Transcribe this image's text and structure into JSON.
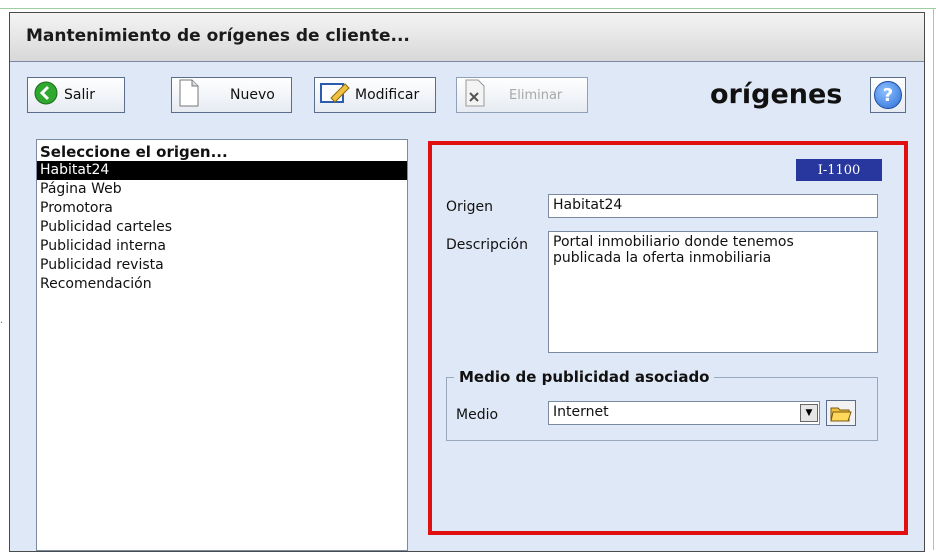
{
  "window": {
    "title": "Mantenimiento de orígenes de cliente..."
  },
  "toolbar": {
    "exit_label": "Salir",
    "new_label": "Nuevo",
    "modify_label": "Modificar",
    "delete_label": "Eliminar",
    "section_word": "orígenes",
    "help_symbol": "?"
  },
  "list": {
    "header": "Seleccione el origen...",
    "items": [
      "Habitat24",
      "Página Web",
      "Promotora",
      "Publicidad carteles",
      "Publicidad interna",
      "Publicidad revista",
      "Recomendación"
    ],
    "selected_index": 0
  },
  "detail": {
    "code": "I-1100",
    "origin_label": "Origen",
    "origin_value": "Habitat24",
    "description_label": "Descripción",
    "description_line1": "Portal inmobiliario donde tenemos",
    "description_line2": "publicada la oferta inmobiliaria",
    "group_title": "Medio de publicidad asociado",
    "medium_label": "Medio",
    "medium_value": "Internet"
  },
  "colors": {
    "accent_red": "#e01010",
    "code_bg": "#27379e",
    "panel_bg": "#dfe8f6"
  },
  "icons": {
    "exit": "green-arrow-left-icon",
    "new": "blank-page-icon",
    "modify": "edit-pencil-icon",
    "delete": "delete-page-icon",
    "help": "help-icon",
    "folder": "open-folder-icon"
  }
}
